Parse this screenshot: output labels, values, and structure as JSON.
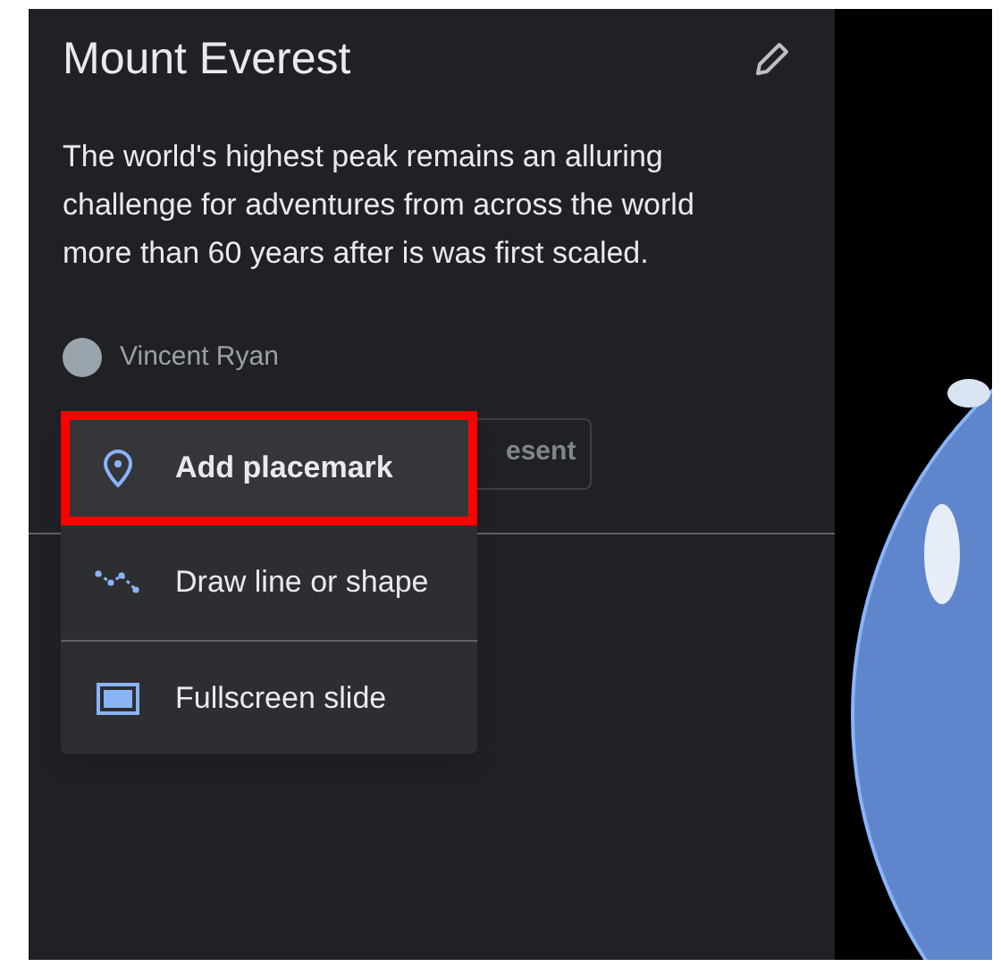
{
  "panel": {
    "title": "Mount Everest",
    "description": "The world's highest peak remains an alluring challenge for adventures from across the world more than 60 years after is was first scaled.",
    "author": "Vincent Ryan",
    "present_button": "esent"
  },
  "menu": {
    "items": [
      {
        "kind": "placemark",
        "label": "Add placemark",
        "selected": true
      },
      {
        "kind": "line",
        "label": "Draw line or shape",
        "selected": false
      },
      {
        "kind": "slide",
        "label": "Fullscreen slide",
        "selected": false
      }
    ]
  }
}
